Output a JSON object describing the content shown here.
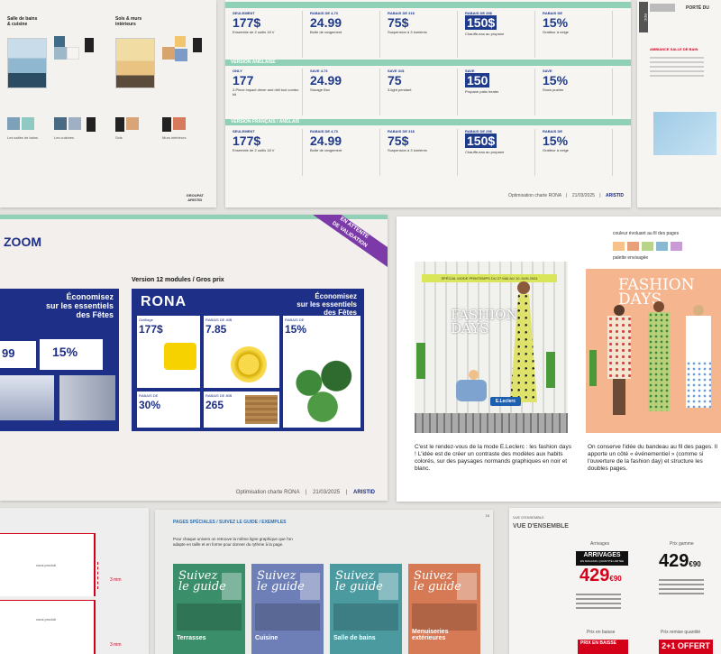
{
  "colors": {
    "teal": "#8fd0b6",
    "navy": "#1d2f86",
    "purple": "#7c3aa8",
    "yellow": "#f5d200",
    "red": "#d4001a"
  },
  "ambiance": {
    "col1_title": "Salle de bains\n& cuisine",
    "col2_title": "Sols & murs\nintérieurs",
    "label_a": "Les salles de bains",
    "label_b": "Les cuisines",
    "label_c": "Sols",
    "label_d": "Murs intérieurs",
    "logo": "GROUPAT\nARISTID"
  },
  "grid": {
    "band1": "VERSION ANGLAISE",
    "band2": "VERSION FRANÇAIS / ANGLAIS",
    "rows": [
      [
        {
          "lab": "SEULEMENT",
          "price": "177$",
          "desc": "Ensemble de 2 outils 18 V"
        },
        {
          "lab": "RABAIS DE 4,73",
          "price": "24.99",
          "desc": "Boîte de rangement"
        },
        {
          "lab": "RABAIS DE 31$",
          "price": "75$",
          "desc": "Suspension à 3 lumières"
        },
        {
          "lab": "RABAIS DE 25$",
          "price": "150$",
          "neg": true,
          "desc": "Chauffe-eau au propane"
        },
        {
          "lab": "RABAIS DE",
          "price": "15%",
          "desc": "Gratteur à neige"
        }
      ],
      [
        {
          "lab": "ONLY",
          "price": "177",
          "desc": "2-Piece impact driver and drill tool combo kit"
        },
        {
          "lab": "SAVE 4.73",
          "price": "24.99",
          "desc": "Storage Box"
        },
        {
          "lab": "SAVE 31$",
          "price": "75",
          "desc": "3-light pendant"
        },
        {
          "lab": "SAVE",
          "price": "150",
          "neg": true,
          "desc": "Propane patio heater"
        },
        {
          "lab": "SAVE",
          "price": "15%",
          "desc": "Snow pusher"
        }
      ],
      [
        {
          "lab": "SEULEMENT",
          "price": "177$",
          "desc": "Ensemble de 2 outils 18 V"
        },
        {
          "lab": "RABAIS DE 4,73",
          "price": "24.99",
          "desc": "Boîte de rangement"
        },
        {
          "lab": "RABAIS DE 31$",
          "price": "75$",
          "desc": "Suspension à 3 lumières"
        },
        {
          "lab": "RABAIS DE 25$",
          "price": "150$",
          "neg": true,
          "desc": "Chauffe-eau au propane"
        },
        {
          "lab": "RABAIS DE",
          "price": "15%",
          "desc": "Gratteur à neige"
        }
      ]
    ],
    "footer": "Optimisation charte RONA",
    "footer_date": "21/03/2025",
    "footer_brand": "ARISTID"
  },
  "side_card": {
    "tag": "RDC",
    "title": "PORTÉ DU",
    "text": "AMBIANCE SALLE DE BAIN"
  },
  "zoom": {
    "title": "ZOOM",
    "ribbon": "EN ATTENTE\nDE VALIDATION",
    "version": "Version 12 modules / Gros prix",
    "brand": "RONA",
    "headline": "Économisez\nsur les essentiels\ndes Fêtes",
    "tiles": [
      {
        "lab": "Outillage",
        "price": "177$"
      },
      {
        "lab": "RABAIS DE 40$",
        "price": "7.85"
      },
      {
        "lab": "RABAIS DE",
        "price": "15%"
      },
      {
        "lab": "RABAIS DE",
        "price": "30%"
      },
      {
        "lab": "RABAIS DE 80$",
        "price": "265"
      }
    ],
    "left_price": "15%",
    "left_price2": "99",
    "footer": "Optimisation charte RONA",
    "footer_date": "21/03/2025",
    "footer_brand": "ARISTID"
  },
  "fashion": {
    "palette_label": "couleur évoluant au fil des pages",
    "palette_label2": "palette envisagée",
    "palette": [
      "#f7c28a",
      "#e8a07a",
      "#b9d38a",
      "#89b8d2",
      "#c89ad6"
    ],
    "mag1_title": "FASHION\nDAYS",
    "mag1_banner": "SPÉCIAL MODE PRINTEMPS DU 27 MAI AU 10 JUIN 2024",
    "mag1_logo": "E.Leclerc",
    "mag2_title": "FASHION DAYS",
    "caption1": "C'est le rendez-vous de la mode E.Leclerc : les fashion days ! L'idée est de créer un contraste des modèles aux habits colorés, sur des paysages normands graphiques en noir et blanc.",
    "caption2": "On conserve l'idée du bandeau au fil des pages. Il apporte un côté « événementiel » (comme si l'ouverture de la fashion day) et structure les doubles pages."
  },
  "measures": {
    "top": "3 mm",
    "bottom": "3 mm",
    "label": "vous produit"
  },
  "guides": {
    "header": "PAGES SPÉCIALES / SUIVEZ LE GUIDE / EXEMPLES",
    "intro": "Pour chaque univers on retrouve la même ligne graphique que l'on adapte en taille et en forme pour donner du rythme à la page.",
    "page_num": "16",
    "title": "Suivez\nle guide",
    "items": [
      {
        "name": "Terrasses",
        "color": "#3b8e6a"
      },
      {
        "name": "Cuisine",
        "color": "#6d7fb6"
      },
      {
        "name": "Salle de bains",
        "color": "#4a9aa0"
      },
      {
        "name": "Menuiseries extérieures",
        "color": "#d57a55"
      }
    ]
  },
  "overview": {
    "kicker": "VUE D'ENSEMBLE",
    "title": "VUE D'ENSEMBLE",
    "col1": "Arrivages",
    "col2": "Prix gamme",
    "badge": "ARRIVAGES",
    "badge_sub": "EN MAGASIN, QUANTITÉ LIMITÉE",
    "price1": "429",
    "cents1": "€90",
    "price2": "429",
    "cents2": "€90",
    "col3": "Prix en baisse",
    "col4": "Prix remise quantité",
    "badge2": "PRIX EN BAISSE",
    "badge3": "2+1 OFFERT"
  }
}
